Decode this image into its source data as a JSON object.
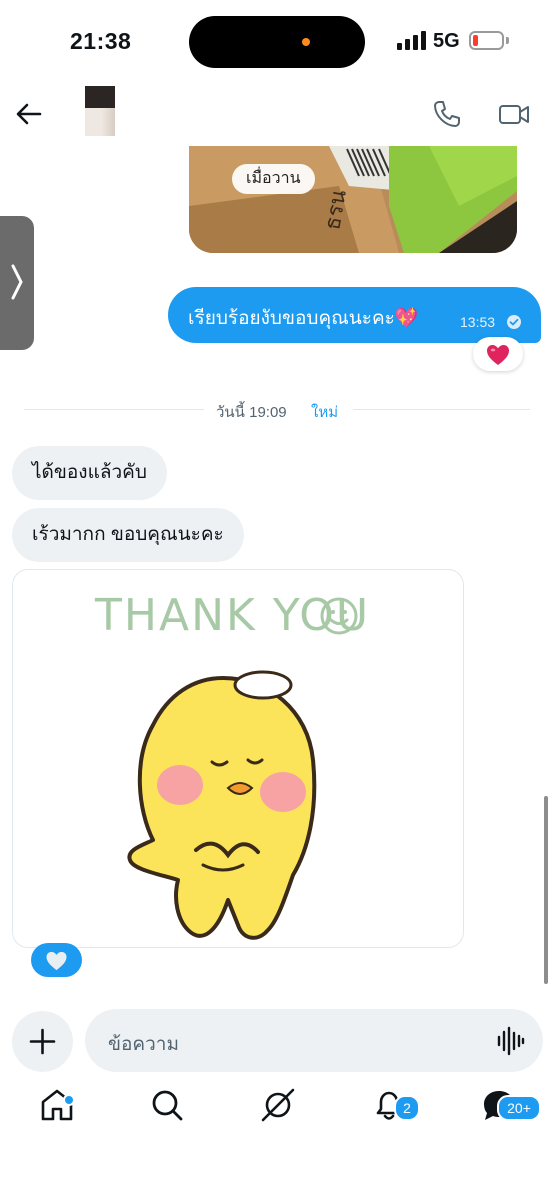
{
  "status_bar": {
    "time": "21:38",
    "network": "5G"
  },
  "header": {
    "back_icon": "arrow-left-icon",
    "call_icon": "phone-icon",
    "video_icon": "video-camera-icon"
  },
  "messages": {
    "photo_chip": "เมื่อวาน",
    "outgoing": {
      "text": "เรียบร้อยงับขอบคุณนะคะ💖",
      "time": "13:53",
      "reaction": "❤️"
    },
    "divider": {
      "label": "วันนี้ 19:09",
      "new_label": "ใหม่"
    },
    "incoming": [
      {
        "text": "ได้ของแล้วคับ"
      },
      {
        "text": "เร้วมากก ขอบคุณนะคะ"
      }
    ],
    "sticker_text": "THANK YOU"
  },
  "composer": {
    "placeholder": "ข้อความ"
  },
  "bottom_nav": {
    "items": [
      {
        "name": "home",
        "icon": "home-icon"
      },
      {
        "name": "search",
        "icon": "search-icon"
      },
      {
        "name": "grok",
        "icon": "grok-icon"
      },
      {
        "name": "notifications",
        "icon": "bell-icon",
        "badge": "2"
      },
      {
        "name": "messages",
        "icon": "mail-icon",
        "badge": "20+"
      }
    ]
  },
  "colors": {
    "accent": "#1d9bf0",
    "bubble_in": "#eef1f3",
    "text": "#0f1419",
    "muted": "#536471"
  }
}
